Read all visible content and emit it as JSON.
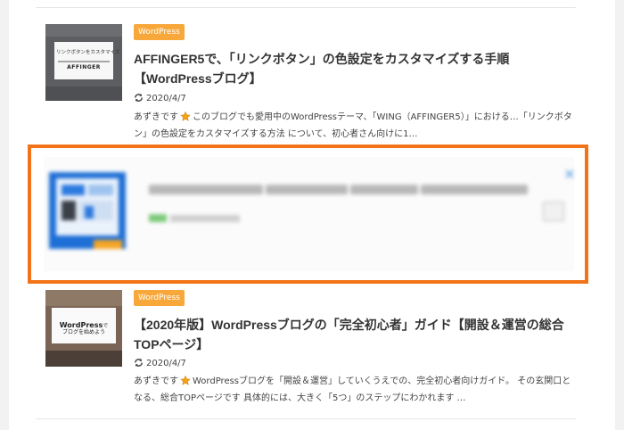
{
  "articles": [
    {
      "category": "WordPress",
      "title": "AFFINGER5で、「リンクボタン」の色設定をカスタマイズする手順【WordPressブログ】",
      "date": "2020/4/7",
      "excerpt_start": "あずきです",
      "excerpt_rest": "このブログでも愛用中のWordPressテーマ、「WING（AFFINGER5）」における…「リンクボタン」の色設定をカスタマイズする方法 について、初心者さん向けに1…",
      "thumbnail": {
        "caption": "リンクボタンをカスタマイズ",
        "label": "AFFINGER"
      }
    },
    {
      "category": "WordPress",
      "title": "【2020年版】WordPressブログの「完全初心者」ガイド【開設＆運営の総合TOPページ】",
      "date": "2020/4/7",
      "excerpt_start": "あずきです",
      "excerpt_rest": "WordPressブログを「開設＆運営」していくうえでの、完全初心者向けガイド。 その玄関口となる、総合TOPページです 具体的には、大きく「5つ」のステップにわかれます …",
      "thumbnail": {
        "line1_a": "WordPress",
        "line1_b": "で",
        "line2": "ブログを始めよう"
      }
    }
  ],
  "ad": {
    "highlight_color": "#f27318"
  },
  "colors": {
    "category_badge": "#f8a83b",
    "star": "#f3a11a"
  },
  "icons": {
    "date": "refresh-icon",
    "excerpt": "star-icon"
  }
}
